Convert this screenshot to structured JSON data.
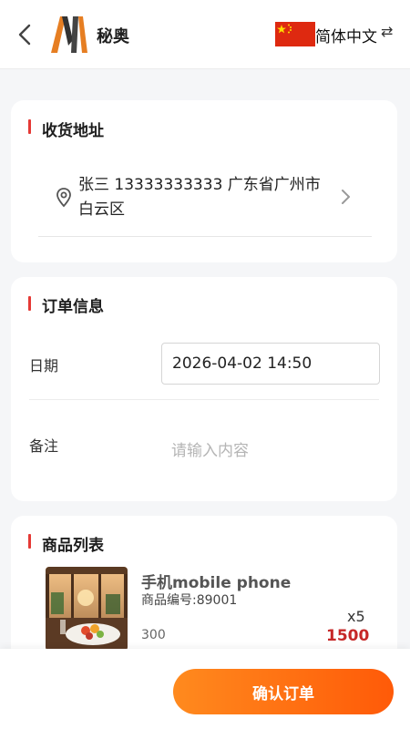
{
  "header": {
    "back_icon": "chevron-left-icon",
    "app_name": "秘奥",
    "flag_icon": "china-flag-icon",
    "language": "简体中文",
    "switch_icon": "swap-arrows-icon"
  },
  "address": {
    "title": "收货地址",
    "text": "张三 13333333333 广东省广州市白云区",
    "location_icon": "location-pin-icon",
    "arrow_icon": "chevron-right-icon"
  },
  "order_info": {
    "title": "订单信息",
    "date_label": "日期",
    "date_value": "2026-04-02 14:50",
    "remark_label": "备注",
    "remark_placeholder": "请输入内容"
  },
  "goods": {
    "title": "商品列表",
    "items": [
      {
        "name": "手机mobile phone",
        "code": "商品编号:89001",
        "quantity": "x5",
        "price": "300",
        "total": "1500"
      }
    ]
  },
  "footer": {
    "confirm_label": "确认订单"
  },
  "colors": {
    "accent": "#e53935",
    "button_start": "#ff8a1e",
    "button_end": "#ff5a08",
    "total_color": "#c62828"
  }
}
